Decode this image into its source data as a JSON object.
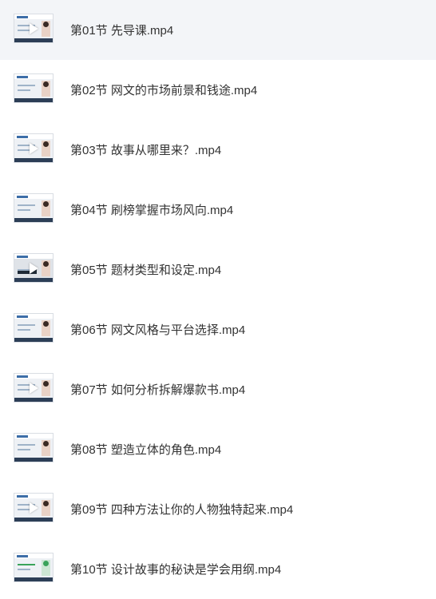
{
  "files": [
    {
      "name": "第01节 先导课.mp4"
    },
    {
      "name": "第02节 网文的市场前景和钱途.mp4"
    },
    {
      "name": "第03节 故事从哪里来？.mp4"
    },
    {
      "name": "第04节 刷榜掌握市场风向.mp4"
    },
    {
      "name": "第05节 题材类型和设定.mp4"
    },
    {
      "name": "第06节 网文风格与平台选择.mp4"
    },
    {
      "name": "第07节 如何分析拆解爆款书.mp4"
    },
    {
      "name": "第08节 塑造立体的角色.mp4"
    },
    {
      "name": "第09节 四种方法让你的人物独特起来.mp4"
    },
    {
      "name": "第10节 设计故事的秘诀是学会用纲.mp4"
    }
  ],
  "colors": {
    "selected_row_bg": "#f3f5f8",
    "title_text": "#333333",
    "thumb_bar": "#2c3e56"
  },
  "icons": {
    "thumbnail_overlay": "play-icon"
  }
}
